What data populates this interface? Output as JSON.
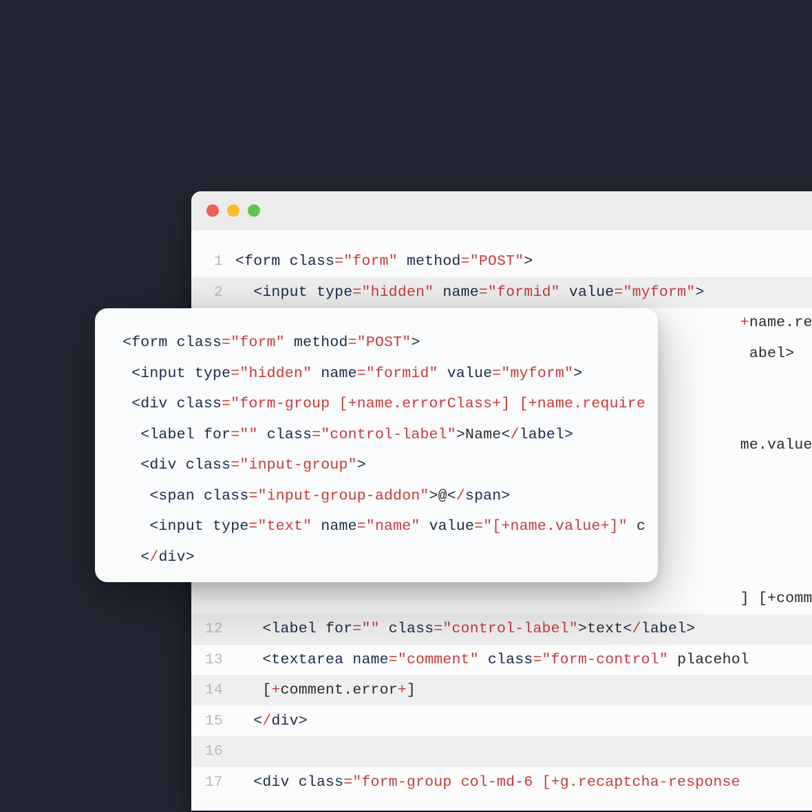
{
  "window": {
    "traffic_lights": {
      "red": "#ec5f56",
      "yellow": "#f7bd2e",
      "green": "#5fc454"
    }
  },
  "editor": {
    "lines": [
      {
        "num": "1",
        "hl": false,
        "tokens": [
          [
            "pnc",
            "<"
          ],
          [
            "tag",
            "form"
          ],
          [
            "txt",
            " "
          ],
          [
            "attr",
            "class"
          ],
          [
            "eq",
            "="
          ],
          [
            "str",
            "\"form\""
          ],
          [
            "txt",
            " "
          ],
          [
            "attr",
            "method"
          ],
          [
            "eq",
            "="
          ],
          [
            "str",
            "\"POST\""
          ],
          [
            "pnc",
            ">"
          ]
        ]
      },
      {
        "num": "2",
        "hl": true,
        "tokens": [
          [
            "txt",
            "  "
          ],
          [
            "pnc",
            "<"
          ],
          [
            "tag",
            "input"
          ],
          [
            "txt",
            " "
          ],
          [
            "attr",
            "type"
          ],
          [
            "eq",
            "="
          ],
          [
            "str",
            "\"hidden\""
          ],
          [
            "txt",
            " "
          ],
          [
            "attr",
            "name"
          ],
          [
            "eq",
            "="
          ],
          [
            "str",
            "\"formid\""
          ],
          [
            "txt",
            " "
          ],
          [
            "attr",
            "value"
          ],
          [
            "eq",
            "="
          ],
          [
            "str",
            "\"myform\""
          ],
          [
            "pnc",
            ">"
          ]
        ]
      },
      {
        "num": "",
        "hl": false,
        "tokens": [
          [
            "txt",
            "                                                        "
          ],
          [
            "plus",
            "+"
          ],
          [
            "txt",
            "name.requi"
          ]
        ]
      },
      {
        "num": "",
        "hl": false,
        "tokens": [
          [
            "txt",
            "                                                         "
          ],
          [
            "txt",
            "abel"
          ],
          [
            "pnc",
            ">"
          ]
        ]
      },
      {
        "num": "",
        "hl": false,
        "tokens": []
      },
      {
        "num": "",
        "hl": false,
        "tokens": []
      },
      {
        "num": "",
        "hl": false,
        "tokens": [
          [
            "txt",
            "                                                        "
          ],
          [
            "txt",
            "me.value"
          ],
          [
            "plus",
            "+"
          ],
          [
            "txt",
            "]\""
          ]
        ]
      },
      {
        "num": "",
        "hl": false,
        "tokens": []
      },
      {
        "num": "",
        "hl": false,
        "tokens": []
      },
      {
        "num": "",
        "hl": false,
        "tokens": []
      },
      {
        "num": "",
        "hl": false,
        "tokens": []
      },
      {
        "num": "",
        "hl": false,
        "tokens": [
          [
            "txt",
            "                                                        "
          ],
          [
            "txt",
            "] [+commen"
          ]
        ]
      },
      {
        "num": "12",
        "hl": true,
        "tokens": [
          [
            "txt",
            "   "
          ],
          [
            "pnc",
            "<"
          ],
          [
            "tag",
            "label"
          ],
          [
            "txt",
            " "
          ],
          [
            "attr",
            "for"
          ],
          [
            "eq",
            "="
          ],
          [
            "str",
            "\"\""
          ],
          [
            "txt",
            " "
          ],
          [
            "attr",
            "class"
          ],
          [
            "eq",
            "="
          ],
          [
            "str",
            "\"control-label\""
          ],
          [
            "pnc",
            ">"
          ],
          [
            "txt",
            "text"
          ],
          [
            "pnc",
            "<"
          ],
          [
            "close",
            "/"
          ],
          [
            "tag",
            "label"
          ],
          [
            "pnc",
            ">"
          ]
        ]
      },
      {
        "num": "13",
        "hl": false,
        "tokens": [
          [
            "txt",
            "   "
          ],
          [
            "pnc",
            "<"
          ],
          [
            "tag",
            "textarea"
          ],
          [
            "txt",
            " "
          ],
          [
            "attr",
            "name"
          ],
          [
            "eq",
            "="
          ],
          [
            "str",
            "\"comment\""
          ],
          [
            "txt",
            " "
          ],
          [
            "attr",
            "class"
          ],
          [
            "eq",
            "="
          ],
          [
            "str",
            "\"form-control\""
          ],
          [
            "txt",
            " placehol"
          ]
        ]
      },
      {
        "num": "14",
        "hl": true,
        "tokens": [
          [
            "txt",
            "   ["
          ],
          [
            "plus",
            "+"
          ],
          [
            "txt",
            "comment.error"
          ],
          [
            "plus",
            "+"
          ],
          [
            "txt",
            "]"
          ]
        ]
      },
      {
        "num": "15",
        "hl": false,
        "tokens": [
          [
            "txt",
            "  "
          ],
          [
            "pnc",
            "<"
          ],
          [
            "close",
            "/"
          ],
          [
            "tag",
            "div"
          ],
          [
            "pnc",
            ">"
          ]
        ]
      },
      {
        "num": "16",
        "hl": true,
        "tokens": []
      },
      {
        "num": "17",
        "hl": false,
        "tokens": [
          [
            "txt",
            "  "
          ],
          [
            "pnc",
            "<"
          ],
          [
            "tag",
            "div"
          ],
          [
            "txt",
            " "
          ],
          [
            "attr",
            "class"
          ],
          [
            "eq",
            "="
          ],
          [
            "str",
            "\"form-group col-md-6 [+g.recaptcha-response"
          ]
        ]
      }
    ]
  },
  "snippet": {
    "lines": [
      {
        "tokens": [
          [
            "pnc",
            "<"
          ],
          [
            "tag",
            "form"
          ],
          [
            "txt",
            " "
          ],
          [
            "attr",
            "class"
          ],
          [
            "eq",
            "="
          ],
          [
            "str",
            "\"form\""
          ],
          [
            "txt",
            " "
          ],
          [
            "attr",
            "method"
          ],
          [
            "eq",
            "="
          ],
          [
            "str",
            "\"POST\""
          ],
          [
            "pnc",
            ">"
          ]
        ]
      },
      {
        "tokens": [
          [
            "txt",
            " "
          ],
          [
            "pnc",
            "<"
          ],
          [
            "tag",
            "input"
          ],
          [
            "txt",
            " "
          ],
          [
            "attr",
            "type"
          ],
          [
            "eq",
            "="
          ],
          [
            "str",
            "\"hidden\""
          ],
          [
            "txt",
            " "
          ],
          [
            "attr",
            "name"
          ],
          [
            "eq",
            "="
          ],
          [
            "str",
            "\"formid\""
          ],
          [
            "txt",
            " "
          ],
          [
            "attr",
            "value"
          ],
          [
            "eq",
            "="
          ],
          [
            "str",
            "\"myform\""
          ],
          [
            "pnc",
            ">"
          ]
        ]
      },
      {
        "tokens": [
          [
            "txt",
            " "
          ],
          [
            "pnc",
            "<"
          ],
          [
            "tag",
            "div"
          ],
          [
            "txt",
            " "
          ],
          [
            "attr",
            "class"
          ],
          [
            "eq",
            "="
          ],
          [
            "str",
            "\"form-group ["
          ],
          [
            "plus",
            "+"
          ],
          [
            "str",
            "name.errorClass"
          ],
          [
            "plus",
            "+"
          ],
          [
            "str",
            "] ["
          ],
          [
            "plus",
            "+"
          ],
          [
            "str",
            "name.require"
          ]
        ]
      },
      {
        "tokens": [
          [
            "txt",
            "  "
          ],
          [
            "pnc",
            "<"
          ],
          [
            "tag",
            "label"
          ],
          [
            "txt",
            " "
          ],
          [
            "attr",
            "for"
          ],
          [
            "eq",
            "="
          ],
          [
            "str",
            "\"\""
          ],
          [
            "txt",
            " "
          ],
          [
            "attr",
            "class"
          ],
          [
            "eq",
            "="
          ],
          [
            "str",
            "\"control-label\""
          ],
          [
            "pnc",
            ">"
          ],
          [
            "txt",
            "Name"
          ],
          [
            "pnc",
            "<"
          ],
          [
            "close",
            "/"
          ],
          [
            "tag",
            "label"
          ],
          [
            "pnc",
            ">"
          ]
        ]
      },
      {
        "tokens": [
          [
            "txt",
            "  "
          ],
          [
            "pnc",
            "<"
          ],
          [
            "tag",
            "div"
          ],
          [
            "txt",
            " "
          ],
          [
            "attr",
            "class"
          ],
          [
            "eq",
            "="
          ],
          [
            "str",
            "\"input-group\""
          ],
          [
            "pnc",
            ">"
          ]
        ]
      },
      {
        "tokens": [
          [
            "txt",
            "   "
          ],
          [
            "pnc",
            "<"
          ],
          [
            "tag",
            "span"
          ],
          [
            "txt",
            " "
          ],
          [
            "attr",
            "class"
          ],
          [
            "eq",
            "="
          ],
          [
            "str",
            "\"input-group-addon\""
          ],
          [
            "pnc",
            ">"
          ],
          [
            "txt",
            "@"
          ],
          [
            "pnc",
            "<"
          ],
          [
            "close",
            "/"
          ],
          [
            "tag",
            "span"
          ],
          [
            "pnc",
            ">"
          ]
        ]
      },
      {
        "tokens": [
          [
            "txt",
            "   "
          ],
          [
            "pnc",
            "<"
          ],
          [
            "tag",
            "input"
          ],
          [
            "txt",
            " "
          ],
          [
            "attr",
            "type"
          ],
          [
            "eq",
            "="
          ],
          [
            "str",
            "\"text\""
          ],
          [
            "txt",
            " "
          ],
          [
            "attr",
            "name"
          ],
          [
            "eq",
            "="
          ],
          [
            "str",
            "\"name\""
          ],
          [
            "txt",
            " "
          ],
          [
            "attr",
            "value"
          ],
          [
            "eq",
            "="
          ],
          [
            "str",
            "\"["
          ],
          [
            "plus",
            "+"
          ],
          [
            "str",
            "name.value"
          ],
          [
            "plus",
            "+"
          ],
          [
            "str",
            "]\""
          ],
          [
            "txt",
            " c"
          ]
        ]
      },
      {
        "tokens": [
          [
            "txt",
            "  "
          ],
          [
            "pnc",
            "<"
          ],
          [
            "close",
            "/"
          ],
          [
            "tag",
            "div"
          ],
          [
            "pnc",
            ">"
          ]
        ]
      }
    ]
  }
}
